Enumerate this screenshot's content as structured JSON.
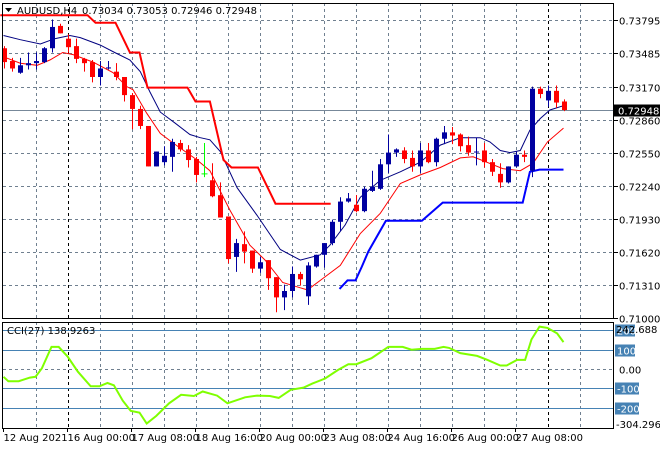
{
  "window": {
    "symbol_label": "AUDUSD,H4",
    "ohlc_readout": "0.73034 0.73053 0.72946 0.72948",
    "menu_icon": "triangle-down-icon"
  },
  "colors": {
    "bull": "#0000a0",
    "bear": "#ff0000",
    "neutral": "#00ff00",
    "ma_blue": "#000080",
    "ma_red": "#ff0000",
    "stop_red": "#ff0000",
    "stop_blue": "#0000ff",
    "cci": "#7fff00",
    "level": "#4682b4",
    "grid": "#708090",
    "day_sep": "#000000"
  },
  "chart_data": [
    {
      "type": "candlestick",
      "title": "AUDUSD,H4",
      "ylim": [
        0.70987,
        0.73955
      ],
      "y_ticks": [
        "0.73795",
        "0.73485",
        "0.73170",
        "0.72860",
        "0.72550",
        "0.72240",
        "0.71930",
        "0.71620",
        "0.71310",
        "0.71000"
      ],
      "current_price": "0.72948",
      "x_tick_every_bars": 8,
      "x_tick_labels": [
        "12 Aug 2021",
        "16 Aug 00:00",
        "17 Aug 08:00",
        "18 Aug 16:00",
        "20 Aug 00:00",
        "23 Aug 08:00",
        "24 Aug 16:00",
        "26 Aug 00:00",
        "27 Aug 08:00"
      ],
      "day_separator_bars": [
        8,
        38,
        68
      ],
      "neutral_bars": [
        25
      ],
      "candles_ohlc": [
        [
          0.7353,
          0.7355,
          0.7334,
          0.734
        ],
        [
          0.7341,
          0.7344,
          0.7331,
          0.7334
        ],
        [
          0.733,
          0.7344,
          0.7329,
          0.7337
        ],
        [
          0.7337,
          0.7349,
          0.7333,
          0.7339
        ],
        [
          0.7339,
          0.7349,
          0.7333,
          0.7341
        ],
        [
          0.734,
          0.7354,
          0.7339,
          0.7353
        ],
        [
          0.7353,
          0.738,
          0.7349,
          0.7373
        ],
        [
          0.7374,
          0.7376,
          0.7367,
          0.7367
        ],
        [
          0.7362,
          0.7366,
          0.7349,
          0.7354
        ],
        [
          0.7355,
          0.7362,
          0.7339,
          0.7343
        ],
        [
          0.7343,
          0.7344,
          0.7331,
          0.7339
        ],
        [
          0.734,
          0.7342,
          0.7321,
          0.7326
        ],
        [
          0.7326,
          0.7341,
          0.7318,
          0.7334
        ],
        [
          0.7334,
          0.7341,
          0.7333,
          0.7335
        ],
        [
          0.7331,
          0.7339,
          0.7323,
          0.7326
        ],
        [
          0.7326,
          0.7326,
          0.7303,
          0.7309
        ],
        [
          0.7309,
          0.7311,
          0.7277,
          0.7296
        ],
        [
          0.7296,
          0.7299,
          0.7277,
          0.728
        ],
        [
          0.728,
          0.728,
          0.7242,
          0.7242
        ],
        [
          0.7242,
          0.7256,
          0.7242,
          0.7256
        ],
        [
          0.7246,
          0.7261,
          0.7243,
          0.7252
        ],
        [
          0.7251,
          0.7268,
          0.7237,
          0.7265
        ],
        [
          0.7264,
          0.7267,
          0.7256,
          0.7258
        ],
        [
          0.7258,
          0.7262,
          0.7241,
          0.7248
        ],
        [
          0.7249,
          0.7251,
          0.7227,
          0.7234
        ],
        [
          0.7235,
          0.7264,
          0.7232,
          0.7235
        ],
        [
          0.7229,
          0.7245,
          0.7213,
          0.7214
        ],
        [
          0.7215,
          0.7227,
          0.7194,
          0.7194
        ],
        [
          0.7195,
          0.7195,
          0.7151,
          0.7155
        ],
        [
          0.7157,
          0.7174,
          0.7143,
          0.717
        ],
        [
          0.7169,
          0.7181,
          0.7151,
          0.7162
        ],
        [
          0.7163,
          0.7163,
          0.7142,
          0.7146
        ],
        [
          0.7146,
          0.7157,
          0.7142,
          0.7152
        ],
        [
          0.7154,
          0.7154,
          0.7126,
          0.7137
        ],
        [
          0.7138,
          0.7138,
          0.7105,
          0.7119
        ],
        [
          0.7119,
          0.7131,
          0.7107,
          0.7125
        ],
        [
          0.7125,
          0.7148,
          0.7119,
          0.7141
        ],
        [
          0.7141,
          0.7143,
          0.713,
          0.7136
        ],
        [
          0.712,
          0.7152,
          0.7112,
          0.7149
        ],
        [
          0.7148,
          0.7159,
          0.7147,
          0.7159
        ],
        [
          0.7159,
          0.717,
          0.7147,
          0.717
        ],
        [
          0.717,
          0.7192,
          0.7168,
          0.719
        ],
        [
          0.719,
          0.7213,
          0.7181,
          0.7209
        ],
        [
          0.7209,
          0.7217,
          0.7208,
          0.7212
        ],
        [
          0.7206,
          0.7215,
          0.7199,
          0.72
        ],
        [
          0.72,
          0.7223,
          0.7199,
          0.7221
        ],
        [
          0.7219,
          0.7238,
          0.7218,
          0.7223
        ],
        [
          0.7221,
          0.7249,
          0.722,
          0.7244
        ],
        [
          0.7244,
          0.7272,
          0.7236,
          0.7255
        ],
        [
          0.7255,
          0.7259,
          0.7251,
          0.7258
        ],
        [
          0.7257,
          0.726,
          0.7245,
          0.7249
        ],
        [
          0.725,
          0.7257,
          0.7237,
          0.7242
        ],
        [
          0.7242,
          0.7264,
          0.7236,
          0.7257
        ],
        [
          0.7257,
          0.7264,
          0.7245,
          0.7246
        ],
        [
          0.7246,
          0.7269,
          0.7242,
          0.7268
        ],
        [
          0.7268,
          0.728,
          0.7263,
          0.7274
        ],
        [
          0.7274,
          0.7279,
          0.7263,
          0.7271
        ],
        [
          0.7272,
          0.7273,
          0.7256,
          0.7261
        ],
        [
          0.7262,
          0.727,
          0.7252,
          0.7255
        ],
        [
          0.7256,
          0.7269,
          0.7243,
          0.7256
        ],
        [
          0.7257,
          0.7264,
          0.7241,
          0.7246
        ],
        [
          0.7246,
          0.7249,
          0.7233,
          0.7237
        ],
        [
          0.7235,
          0.7245,
          0.7222,
          0.7227
        ],
        [
          0.7227,
          0.7242,
          0.7226,
          0.7242
        ],
        [
          0.7242,
          0.7256,
          0.7241,
          0.7253
        ],
        [
          0.7253,
          0.7257,
          0.7246,
          0.7251
        ],
        [
          0.7238,
          0.7317,
          0.7232,
          0.7315
        ],
        [
          0.7315,
          0.7317,
          0.7306,
          0.731
        ],
        [
          0.7304,
          0.7318,
          0.7298,
          0.7313
        ],
        [
          0.7313,
          0.7318,
          0.7297,
          0.7302
        ],
        [
          0.7303,
          0.7305,
          0.7294,
          0.7295
        ]
      ],
      "overlays": [
        {
          "name": "ma-blue",
          "points": [
            [
              0,
              0.7365
            ],
            [
              2.1,
              0.7361
            ],
            [
              4.6,
              0.7357
            ],
            [
              6.4,
              0.7362
            ],
            [
              8.3,
              0.7365
            ],
            [
              9.6,
              0.7363
            ],
            [
              12.1,
              0.7356
            ],
            [
              13.9,
              0.7349
            ],
            [
              15.8,
              0.7342
            ],
            [
              17.1,
              0.7331
            ],
            [
              18.3,
              0.7312
            ],
            [
              19.6,
              0.7293
            ],
            [
              21.4,
              0.7283
            ],
            [
              23.3,
              0.7272
            ],
            [
              24.6,
              0.7269
            ],
            [
              25.8,
              0.7267
            ],
            [
              27.1,
              0.7256
            ],
            [
              29.2,
              0.7222
            ],
            [
              31.7,
              0.7196
            ],
            [
              34.6,
              0.7164
            ],
            [
              37.1,
              0.7154
            ],
            [
              39.6,
              0.7159
            ],
            [
              40.8,
              0.7168
            ],
            [
              42.7,
              0.7187
            ],
            [
              44.6,
              0.7213
            ],
            [
              47.1,
              0.7229
            ],
            [
              49.6,
              0.7237
            ],
            [
              52.1,
              0.7246
            ],
            [
              54.6,
              0.7262
            ],
            [
              57.1,
              0.7269
            ],
            [
              59.6,
              0.7269
            ],
            [
              60.8,
              0.7265
            ],
            [
              62.1,
              0.7257
            ],
            [
              63.3,
              0.7255
            ],
            [
              64.6,
              0.7257
            ],
            [
              65.8,
              0.7276
            ],
            [
              67.1,
              0.7287
            ],
            [
              68.3,
              0.7295
            ],
            [
              70,
              0.7299
            ]
          ]
        },
        {
          "name": "ma-red",
          "points": [
            [
              0,
              0.7345
            ],
            [
              2.1,
              0.7339
            ],
            [
              4.2,
              0.7337
            ],
            [
              5.8,
              0.7342
            ],
            [
              7.4,
              0.7349
            ],
            [
              8.7,
              0.7347
            ],
            [
              11.2,
              0.734
            ],
            [
              13.7,
              0.733
            ],
            [
              15.4,
              0.7317
            ],
            [
              16.2,
              0.7314
            ],
            [
              17.9,
              0.7292
            ],
            [
              19.6,
              0.7273
            ],
            [
              21.2,
              0.7264
            ],
            [
              24.2,
              0.7248
            ],
            [
              25.8,
              0.7238
            ],
            [
              28.3,
              0.7201
            ],
            [
              30.8,
              0.7168
            ],
            [
              32.7,
              0.7154
            ],
            [
              34.9,
              0.7133
            ],
            [
              37.1,
              0.7128
            ],
            [
              38,
              0.7126
            ],
            [
              39.6,
              0.7135
            ],
            [
              42.1,
              0.7149
            ],
            [
              44.6,
              0.7179
            ],
            [
              47.1,
              0.7198
            ],
            [
              49.6,
              0.7226
            ],
            [
              52.1,
              0.7234
            ],
            [
              54.6,
              0.7241
            ],
            [
              57.1,
              0.725
            ],
            [
              58.7,
              0.7251
            ],
            [
              60.4,
              0.7246
            ],
            [
              62.4,
              0.724
            ],
            [
              64.6,
              0.7238
            ],
            [
              66.2,
              0.7245
            ],
            [
              68,
              0.7265
            ],
            [
              70,
              0.7278
            ]
          ]
        },
        {
          "name": "stop-red",
          "points": [
            [
              -0.4,
              0.7384
            ],
            [
              10.5,
              0.7384
            ],
            [
              11.5,
              0.7377
            ],
            [
              14,
              0.7377
            ],
            [
              15.8,
              0.7349
            ],
            [
              17,
              0.7349
            ],
            [
              18,
              0.7316
            ],
            [
              23,
              0.7316
            ],
            [
              24,
              0.7303
            ],
            [
              25.8,
              0.7303
            ],
            [
              27.5,
              0.7248
            ],
            [
              28.5,
              0.7241
            ],
            [
              31.8,
              0.7241
            ],
            [
              34,
              0.7207
            ],
            [
              40.9,
              0.7207
            ]
          ]
        },
        {
          "name": "stop-blue",
          "points": [
            [
              42,
              0.7127
            ],
            [
              43,
              0.7135
            ],
            [
              44,
              0.7135
            ],
            [
              44.8,
              0.7148
            ],
            [
              45.6,
              0.7162
            ],
            [
              47.8,
              0.7191
            ],
            [
              52.3,
              0.7191
            ],
            [
              54.9,
              0.7208
            ],
            [
              64.9,
              0.7208
            ],
            [
              65.8,
              0.7237
            ],
            [
              67,
              0.7239
            ],
            [
              70,
              0.7239
            ]
          ]
        }
      ]
    },
    {
      "type": "line",
      "title": "CCI(27) 138.9263",
      "ylim": [
        -304.2964,
        242.688
      ],
      "levels": [
        200,
        100,
        -100,
        -200
      ],
      "level_labels": [
        "200",
        "100",
        "-100",
        "-200"
      ],
      "zero_label": "0.00",
      "max_label": "242.688",
      "min_label": "-304.2964",
      "points": [
        [
          0,
          -40
        ],
        [
          0.6,
          -63
        ],
        [
          1.9,
          -63
        ],
        [
          3.3,
          -44
        ],
        [
          4,
          -40
        ],
        [
          4.8,
          4
        ],
        [
          6,
          114
        ],
        [
          6.9,
          114
        ],
        [
          8,
          65
        ],
        [
          9.3,
          -14
        ],
        [
          10.9,
          -89
        ],
        [
          12,
          -89
        ],
        [
          13,
          -72
        ],
        [
          13.8,
          -84
        ],
        [
          14.9,
          -163
        ],
        [
          15.9,
          -216
        ],
        [
          17,
          -225
        ],
        [
          17.9,
          -281
        ],
        [
          19.1,
          -242
        ],
        [
          20.7,
          -177
        ],
        [
          22.2,
          -133
        ],
        [
          23.8,
          -139
        ],
        [
          24.9,
          -116
        ],
        [
          26.7,
          -137
        ],
        [
          28,
          -177
        ],
        [
          30.2,
          -146
        ],
        [
          31.7,
          -137
        ],
        [
          33.3,
          -139
        ],
        [
          34.4,
          -149
        ],
        [
          35.9,
          -107
        ],
        [
          37.5,
          -96
        ],
        [
          38.6,
          -75
        ],
        [
          40.2,
          -49
        ],
        [
          41.8,
          -5
        ],
        [
          43.1,
          25
        ],
        [
          44.1,
          25
        ],
        [
          46,
          56
        ],
        [
          48.1,
          114
        ],
        [
          49.9,
          114
        ],
        [
          51,
          100
        ],
        [
          52.3,
          104
        ],
        [
          53.9,
          104
        ],
        [
          55,
          114
        ],
        [
          55.7,
          109
        ],
        [
          57.1,
          82
        ],
        [
          59.2,
          68
        ],
        [
          60.5,
          47
        ],
        [
          62.1,
          18
        ],
        [
          62.9,
          18
        ],
        [
          64.2,
          47
        ],
        [
          65.2,
          47
        ],
        [
          66,
          153
        ],
        [
          67,
          219
        ],
        [
          68,
          212
        ],
        [
          69.2,
          184
        ],
        [
          70,
          139
        ]
      ]
    }
  ]
}
